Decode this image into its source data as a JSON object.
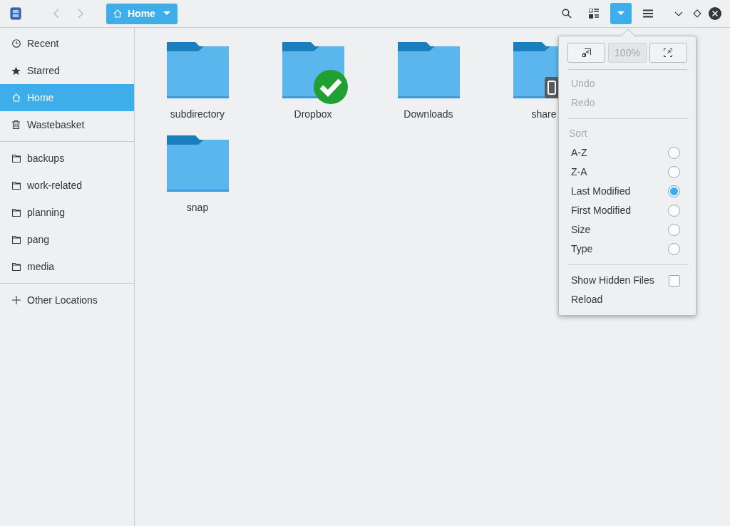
{
  "toolbar": {
    "back_disabled": true,
    "forward_disabled": true,
    "location": "Home",
    "buttons": [
      {
        "kind": "search",
        "selected": false
      },
      {
        "kind": "view",
        "selected": false
      },
      {
        "kind": "dropdown",
        "selected": true
      },
      {
        "kind": "menu",
        "selected": false
      }
    ]
  },
  "sidebar": {
    "groups": [
      [
        {
          "kind": "recent",
          "label": "Recent",
          "selected": false
        },
        {
          "kind": "starred",
          "label": "Starred",
          "selected": false
        },
        {
          "kind": "home",
          "label": "Home",
          "selected": true
        },
        {
          "kind": "trash",
          "label": "Wastebasket",
          "selected": false
        }
      ],
      [
        {
          "kind": "folder",
          "label": "backups",
          "selected": false
        },
        {
          "kind": "folder",
          "label": "work-related",
          "selected": false
        },
        {
          "kind": "folder",
          "label": "planning",
          "selected": false
        },
        {
          "kind": "folder",
          "label": "pang",
          "selected": false
        },
        {
          "kind": "folder",
          "label": "media",
          "selected": false
        }
      ],
      [
        {
          "kind": "add",
          "label": "Other Locations",
          "selected": false
        }
      ]
    ]
  },
  "folders": [
    {
      "name": "subdirectory",
      "kind": "plain"
    },
    {
      "name": "Dropbox",
      "kind": "synced"
    },
    {
      "name": "Downloads",
      "kind": "plain"
    },
    {
      "name": "share",
      "kind": "shared"
    },
    {
      "name": "snap",
      "kind": "plain"
    }
  ],
  "popover": {
    "zoom": [
      {
        "kind": "zoom-out",
        "disabled": false
      },
      {
        "kind": "reset",
        "label": "100%",
        "disabled": true
      },
      {
        "kind": "zoom-in",
        "disabled": false
      }
    ],
    "edit": [
      {
        "label": "Undo",
        "disabled": true
      },
      {
        "label": "Redo",
        "disabled": true
      }
    ],
    "sort_heading": "Sort",
    "sort": [
      {
        "label": "A-Z",
        "selected": false
      },
      {
        "label": "Z-A",
        "selected": false
      },
      {
        "label": "Last Modified",
        "selected": true
      },
      {
        "label": "First Modified",
        "selected": false
      },
      {
        "label": "Size",
        "selected": false
      },
      {
        "label": "Type",
        "selected": false
      }
    ],
    "show_hidden": {
      "label": "Show Hidden Files",
      "checked": false
    },
    "reload": "Reload"
  }
}
